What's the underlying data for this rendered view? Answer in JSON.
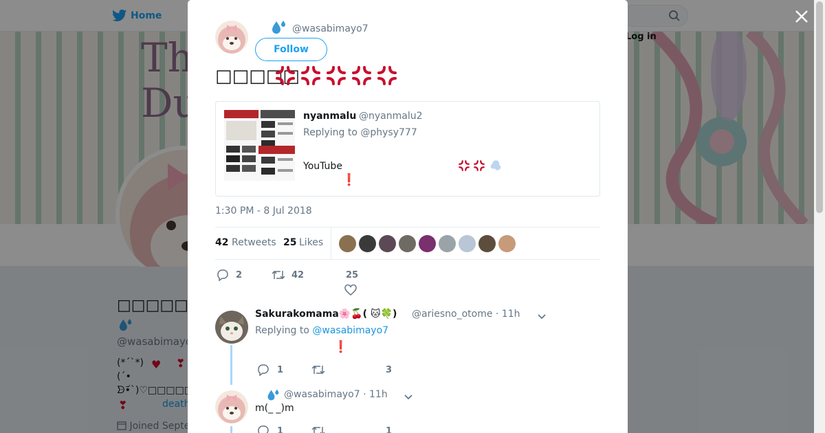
{
  "background": {
    "nav_home": "Home",
    "login": "Log in",
    "banner_text": "Th\nDu",
    "profile_name": "□□□□□□□□",
    "profile_handle": "@wasabimayo",
    "bio_line1": "(*´`*)",
    "bio_line2": "(´•",
    "bio_line3": "ᗦ•᷄`)♡□□□□□□",
    "bio_link": "death",
    "joined": "Joined Septe",
    "accent": "#1da1f2"
  },
  "tweet": {
    "author_handle": "@wasabimayo7",
    "follow_label": "Follow",
    "text": "□□□□□",
    "anger_icons": [
      "anger-icon",
      "anger-icon",
      "anger-icon",
      "anger-icon",
      "anger-icon"
    ],
    "timestamp": "1:30 PM - 8 Jul 2018",
    "retweets": "42",
    "retweets_label": "Retweets",
    "likes": "25",
    "likes_label": "Likes",
    "actions": {
      "reply_count": "2",
      "retweet_count": "42",
      "like_count": "25"
    }
  },
  "quoted_tweet": {
    "name": "nyanmalu",
    "handle": "@nyanmalu2",
    "replying": "Replying to @physy777",
    "text": "YouTube",
    "emoji_icons": [
      "anger-icon",
      "anger-icon",
      "dash-icon"
    ],
    "exclamation": "❗"
  },
  "replies": [
    {
      "name": "Sakurakomama🌸🍒( 🐱🍀)",
      "handle": "@ariesno_otome",
      "time": "· 11h",
      "replying_prefix": "Replying to ",
      "replying_to": "@wasabimayo7",
      "exclamation": "❗",
      "reply_count": "1",
      "retweet_count": "",
      "like_count": "3"
    },
    {
      "handle": "@wasabimayo7",
      "time": "· 11h",
      "text": "m(_ _)m",
      "reply_count": "1",
      "like_count": "1"
    }
  ],
  "colors": {
    "accent": "#1da1f2",
    "anger": "#c8102e",
    "muted": "#657786"
  }
}
